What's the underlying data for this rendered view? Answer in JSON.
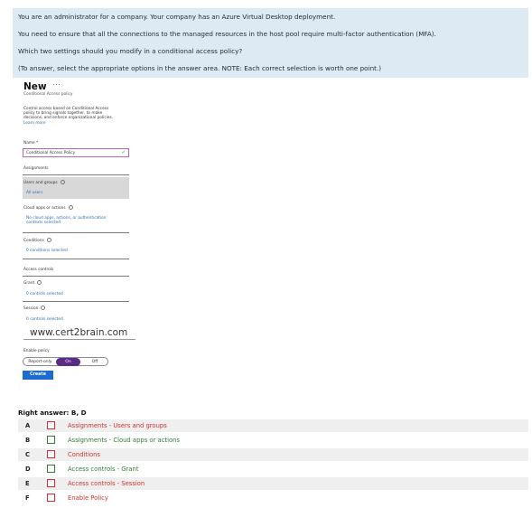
{
  "question": {
    "line1": "You are an administrator for a company. Your company has an Azure Virtual Desktop deployment.",
    "line2": "You need to ensure that all the connections to the managed resources in the host pool require multi-factor authentication (MFA).",
    "line3": "Which two settings should you modify in a conditional access policy?",
    "line4": "(To answer, select the appropriate options in the answer area. NOTE: Each correct selection is worth one point.)"
  },
  "policy_panel": {
    "title": "New",
    "more_dots": "···",
    "subtitle": "Conditional Access policy",
    "description_l1": "Control access based on Conditional Access",
    "description_l2": "policy to bring signals together, to make",
    "description_l3": "decisions, and enforce organizational policies.",
    "learn_more": "Learn more",
    "name_label": "Name *",
    "name_value": "Conditional Access Policy",
    "name_valid_icon": "✓",
    "assignments_label": "Assignments",
    "users_label": "Users and groups",
    "users_value": "All users",
    "cloud_label": "Cloud apps or actions",
    "cloud_value_l1": "No cloud apps, actions, or authentication",
    "cloud_value_l2": "contexts selected",
    "conditions_label": "Conditions",
    "conditions_value": "0 conditions selected",
    "access_controls_label": "Access controls",
    "grant_label": "Grant",
    "grant_value": "0 controls selected",
    "session_label": "Session",
    "session_value": "0 controls selected",
    "enable_label": "Enable policy",
    "toggle_report": "Report-only",
    "toggle_on": "On",
    "toggle_off": "Off",
    "create_label": "Create"
  },
  "watermark": "www.cert2brain.com",
  "answer": {
    "title": "Right answer: B, D",
    "options": [
      {
        "letter": "A",
        "text": "Assignments - Users and groups",
        "correct": false
      },
      {
        "letter": "B",
        "text": "Assignments - Cloud apps or actions",
        "correct": true
      },
      {
        "letter": "C",
        "text": "Conditions",
        "correct": false
      },
      {
        "letter": "D",
        "text": "Access controls - Grant",
        "correct": true
      },
      {
        "letter": "E",
        "text": "Access controls - Session",
        "correct": false
      },
      {
        "letter": "F",
        "text": "Enable Policy",
        "correct": false
      }
    ]
  },
  "colors": {
    "correct": "#2e7d32",
    "incorrect": "#d32f2f",
    "question_bg": "#dde9f3",
    "link": "#2a6fb8",
    "toggle_on": "#5b2a86",
    "create_button": "#1b6bd0"
  }
}
